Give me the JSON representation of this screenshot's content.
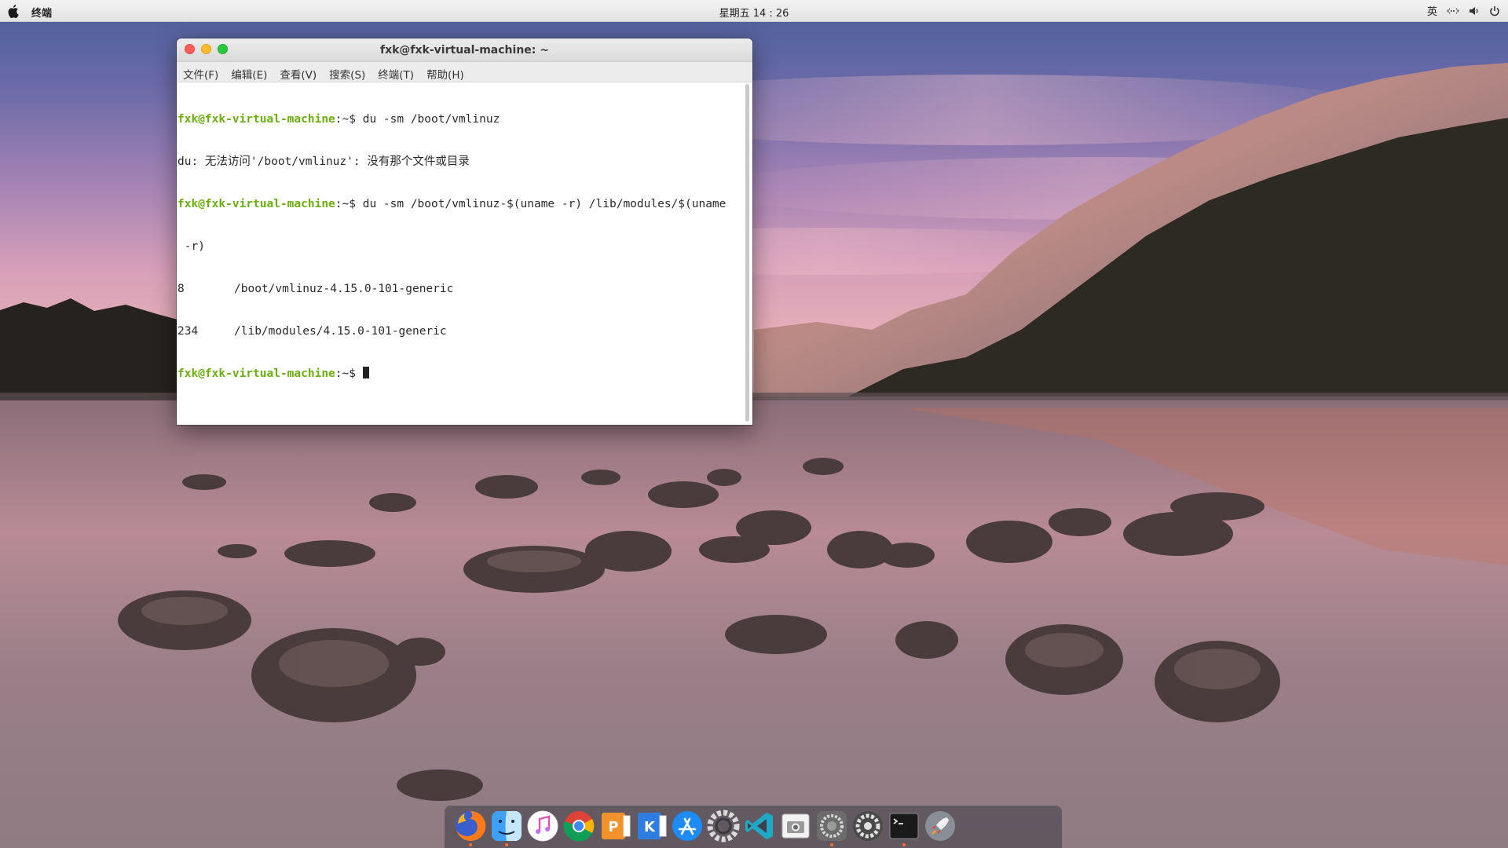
{
  "topbar": {
    "app_name": "终端",
    "clock": "星期五 14 : 26",
    "input_method": "英"
  },
  "terminal": {
    "title": "fxk@fxk-virtual-machine: ~",
    "menu": [
      "文件(F)",
      "编辑(E)",
      "查看(V)",
      "搜索(S)",
      "终端(T)",
      "帮助(H)"
    ],
    "prompt_user": "fxk@fxk-virtual-machine",
    "prompt_suffix": ":~$ ",
    "cmd1": "du -sm /boot/vmlinuz",
    "err1": "du: 无法访问'/boot/vmlinuz': 没有那个文件或目录",
    "cmd2": "du -sm /boot/vmlinuz-$(uname -r) /lib/modules/$(uname",
    "cmd2_wrap": " -r)",
    "out1_size": "8",
    "out1_path": "/boot/vmlinuz-4.15.0-101-generic",
    "out2_size": "234",
    "out2_path": "/lib/modules/4.15.0-101-generic"
  },
  "dock": {
    "items": [
      {
        "name": "firefox-icon",
        "running": true
      },
      {
        "name": "finder-icon",
        "running": true
      },
      {
        "name": "itunes-icon",
        "running": false
      },
      {
        "name": "chrome-icon",
        "running": false
      },
      {
        "name": "wps-presentation-icon",
        "running": false
      },
      {
        "name": "kingsoft-writer-icon",
        "running": false
      },
      {
        "name": "app-store-icon",
        "running": false
      },
      {
        "name": "settings-ring-icon",
        "running": false
      },
      {
        "name": "vscode-icon",
        "running": false
      },
      {
        "name": "screenshot-icon",
        "running": false
      },
      {
        "name": "system-preferences-icon",
        "running": true
      },
      {
        "name": "settings-gear-icon",
        "running": false
      },
      {
        "name": "terminal-icon",
        "running": true
      },
      {
        "name": "launchpad-rocket-icon",
        "running": false
      }
    ]
  },
  "colors": {
    "prompt_green": "#6ab00e",
    "close_red": "#fc5f57",
    "min_yellow": "#fdbc2e",
    "max_green": "#28c840"
  }
}
